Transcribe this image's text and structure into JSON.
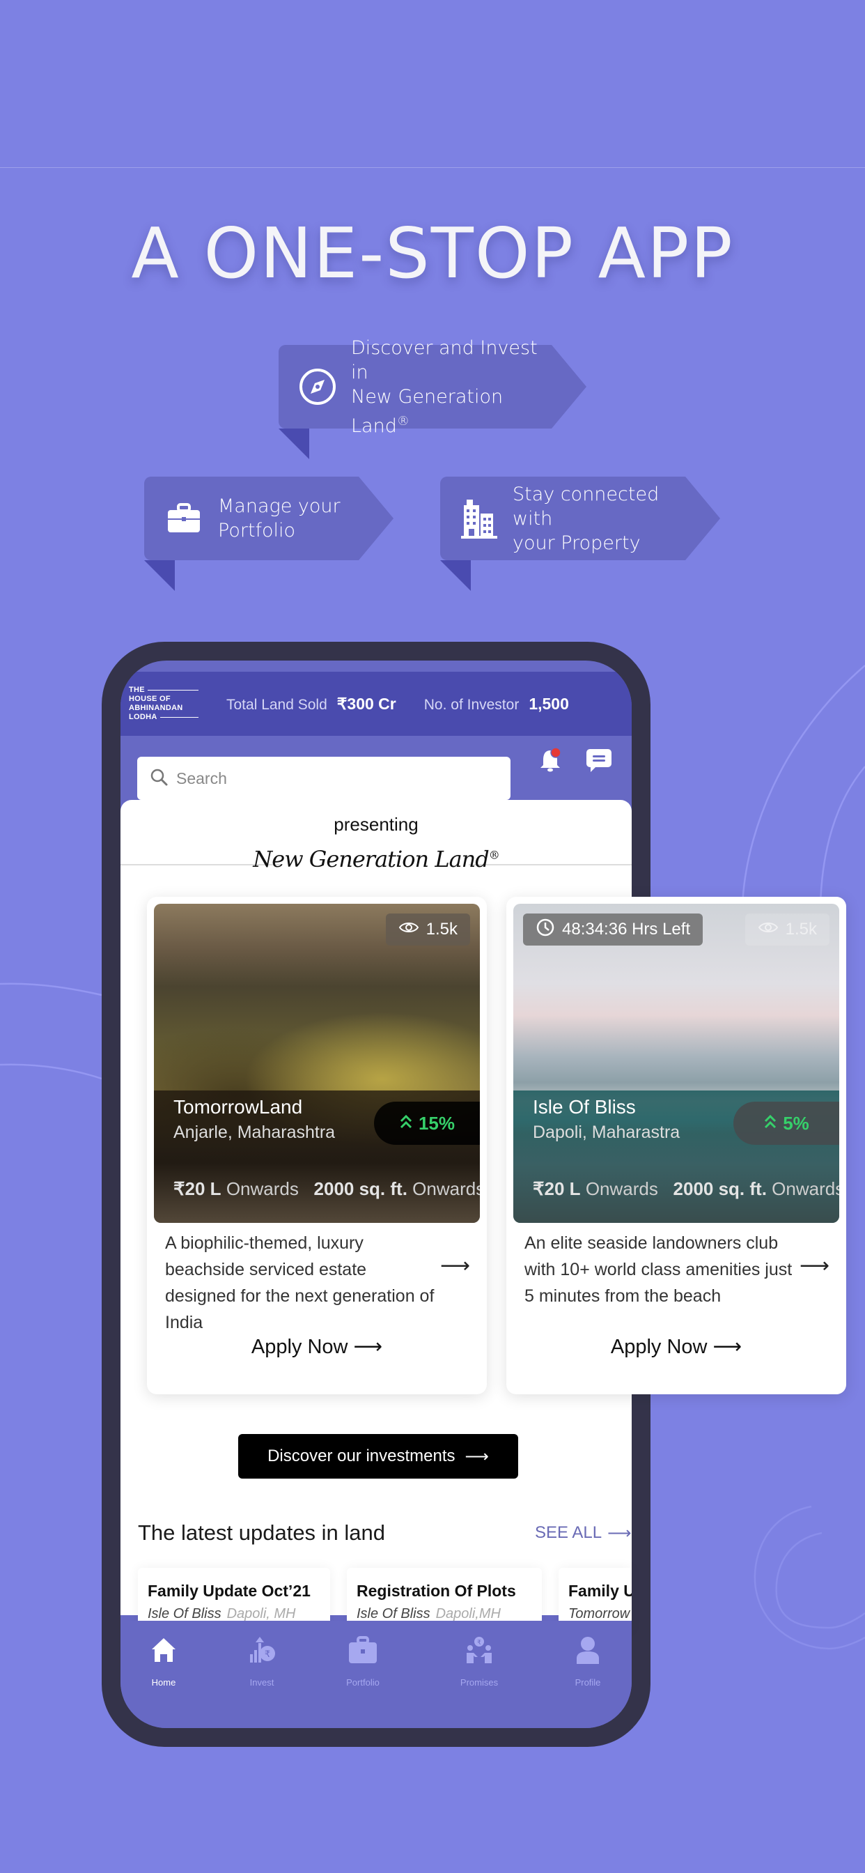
{
  "hero": {
    "title": "A ONE-STOP APP"
  },
  "features": [
    {
      "icon": "compass-icon",
      "line1": "Discover and Invest in",
      "line2": "New Generation Land",
      "mark": "®"
    },
    {
      "icon": "briefcase-icon",
      "line1": "Manage your",
      "line2": "Portfolio",
      "mark": ""
    },
    {
      "icon": "buildings-icon",
      "line1": "Stay connected with",
      "line2": "your Property",
      "mark": ""
    }
  ],
  "app": {
    "logo": [
      "THE",
      "HOUSE OF",
      "ABHINANDAN",
      "LODHA"
    ],
    "stats": [
      {
        "label": "Total Land Sold",
        "value": "₹300 Cr"
      },
      {
        "label": "No. of Investor",
        "value": "1,500"
      }
    ],
    "search": {
      "placeholder": "Search",
      "value": ""
    },
    "notifications": {
      "has_unread": true,
      "badge_color": "#e53935"
    },
    "presenting": "presenting",
    "brand_script": "New Generation Land",
    "brand_mark": "®",
    "properties": [
      {
        "name": "TomorrowLand",
        "location": "Anjarle, Maharashtra",
        "views": "1.5k",
        "timer": "",
        "growth": "15%",
        "price": "₹20 L",
        "price_suffix": "Onwards",
        "area": "2000 sq. ft.",
        "area_suffix": "Onwards",
        "description": "A biophilic-themed, luxury beachside serviced estate designed for the next generation of India",
        "cta": "Apply Now"
      },
      {
        "name": "Isle Of Bliss",
        "location": "Dapoli, Maharastra",
        "views": "1.5k",
        "timer": "48:34:36 Hrs Left",
        "growth": "5%",
        "price": "₹20 L",
        "price_suffix": "Onwards",
        "area": "2000 sq. ft.",
        "area_suffix": "Onwards",
        "description": "An elite seaside landowners club with 10+ world class amenities just 5 minutes from the beach",
        "cta": "Apply Now"
      }
    ],
    "discover_button": "Discover our investments",
    "updates": {
      "title": "The latest updates in land",
      "see_all": "SEE ALL",
      "items": [
        {
          "title": "Family Update Oct’21",
          "project": "Isle Of Bliss",
          "place": "Dapoli, MH"
        },
        {
          "title": "Registration Of Plots",
          "project": "Isle Of Bliss",
          "place": "Dapoli,MH"
        },
        {
          "title": "Family U",
          "project": "Tomorrow",
          "place": ""
        }
      ]
    },
    "tabs": [
      {
        "label": "Home",
        "icon": "home-icon",
        "active": true
      },
      {
        "label": "Invest",
        "icon": "invest-icon",
        "active": false
      },
      {
        "label": "Portfolio",
        "icon": "briefcase-icon",
        "active": false
      },
      {
        "label": "Promises",
        "icon": "handshake-icon",
        "active": false
      },
      {
        "label": "Profile",
        "icon": "user-icon",
        "active": false
      }
    ]
  },
  "colors": {
    "background": "#7d81e3",
    "ribbon": "#6769c4",
    "app_primary": "#6769c4",
    "app_header": "#4a4bae",
    "growth_green": "#36d06a",
    "phone_frame": "#34334a"
  }
}
